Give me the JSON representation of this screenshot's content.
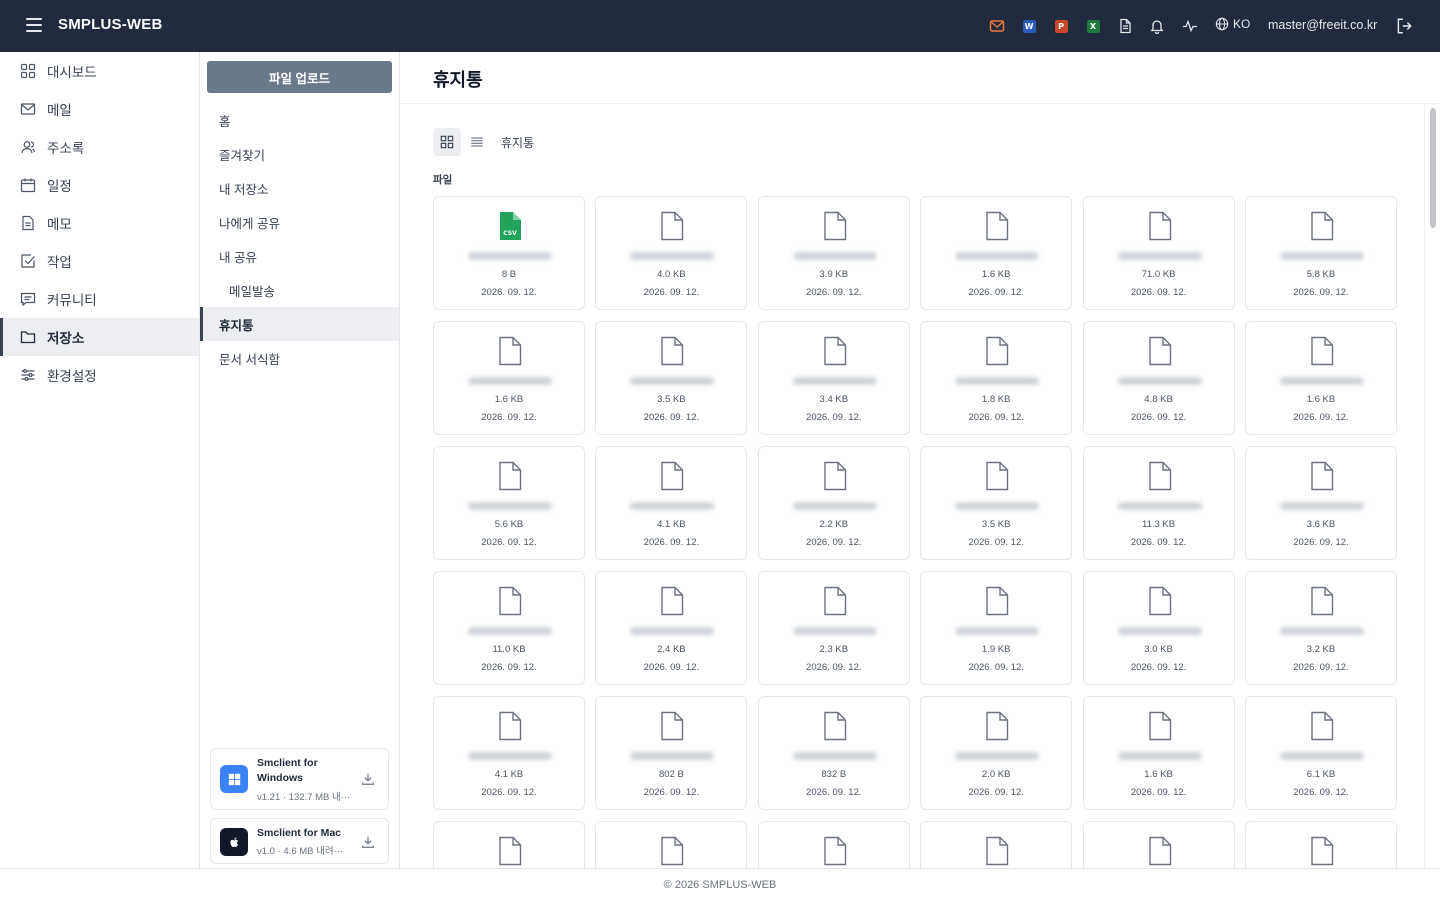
{
  "header": {
    "app_title": "SMPLUS-WEB",
    "icons": [
      "mail-icon",
      "word-icon",
      "powerpoint-icon",
      "excel-icon",
      "document-icon",
      "bell-icon",
      "activity-icon",
      "globe-icon"
    ],
    "word_letter": "W",
    "ppt_letter": "P",
    "excel_letter": "X",
    "lang": "KO",
    "user_email": "master@freeit.co.kr",
    "colors": {
      "bar": "#212b3d",
      "mail": "#f07a3e",
      "word": "#2b5cb8",
      "ppt": "#c8462c",
      "excel": "#1f7a3f"
    }
  },
  "leftnav": {
    "items": [
      {
        "label": "대시보드",
        "icon": "dashboard-icon",
        "active": false
      },
      {
        "label": "메일",
        "icon": "mail-icon",
        "active": false
      },
      {
        "label": "주소록",
        "icon": "contacts-icon",
        "active": false
      },
      {
        "label": "일정",
        "icon": "calendar-icon",
        "active": false
      },
      {
        "label": "메모",
        "icon": "memo-icon",
        "active": false
      },
      {
        "label": "작업",
        "icon": "task-icon",
        "active": false
      },
      {
        "label": "커뮤니티",
        "icon": "community-icon",
        "active": false
      },
      {
        "label": "저장소",
        "icon": "folder-icon",
        "active": true
      },
      {
        "label": "환경설정",
        "icon": "settings-icon",
        "active": false
      }
    ]
  },
  "subnav": {
    "upload_label": "파일 업로드",
    "items": [
      {
        "label": "홈"
      },
      {
        "label": "즐겨찾기"
      },
      {
        "label": "내 저장소"
      },
      {
        "label": "나에게 공유"
      },
      {
        "label": "내 공유"
      },
      {
        "label": "메일발송"
      },
      {
        "label": "휴지통"
      },
      {
        "label": "문서 서식함"
      }
    ],
    "apps": [
      {
        "name": "Smclient for Windows",
        "meta": "v1.21 · 132.7 MB 내···",
        "icon": "windows-icon"
      },
      {
        "name": "Smclient for Mac",
        "meta": "v1.0 · 4.6 MB 내려···",
        "icon": "apple-icon"
      }
    ]
  },
  "main": {
    "title": "휴지통",
    "breadcrumb": "휴지통",
    "section_label": "파일",
    "csv_tag": "CSV",
    "files": [
      {
        "type": "csv",
        "size": "8 B",
        "date": "2026. 09. 12."
      },
      {
        "type": "file",
        "size": "4.0 KB",
        "date": "2026. 09. 12."
      },
      {
        "type": "file",
        "size": "3.9 KB",
        "date": "2026. 09. 12."
      },
      {
        "type": "file",
        "size": "1.6 KB",
        "date": "2026. 09. 12."
      },
      {
        "type": "file",
        "size": "71.0 KB",
        "date": "2026. 09. 12."
      },
      {
        "type": "file",
        "size": "5.8 KB",
        "date": "2026. 09. 12."
      },
      {
        "type": "file",
        "size": "1.6 KB",
        "date": "2026. 09. 12."
      },
      {
        "type": "file",
        "size": "3.5 KB",
        "date": "2026. 09. 12."
      },
      {
        "type": "file",
        "size": "3.4 KB",
        "date": "2026. 09. 12."
      },
      {
        "type": "file",
        "size": "1.8 KB",
        "date": "2026. 09. 12."
      },
      {
        "type": "file",
        "size": "4.8 KB",
        "date": "2026. 09. 12."
      },
      {
        "type": "file",
        "size": "1.6 KB",
        "date": "2026. 09. 12."
      },
      {
        "type": "file",
        "size": "5.6 KB",
        "date": "2026. 09. 12."
      },
      {
        "type": "file",
        "size": "4.1 KB",
        "date": "2026. 09. 12."
      },
      {
        "type": "file",
        "size": "2.2 KB",
        "date": "2026. 09. 12."
      },
      {
        "type": "file",
        "size": "3.5 KB",
        "date": "2026. 09. 12."
      },
      {
        "type": "file",
        "size": "11.3 KB",
        "date": "2026. 09. 12."
      },
      {
        "type": "file",
        "size": "3.6 KB",
        "date": "2026. 09. 12."
      },
      {
        "type": "file",
        "size": "11.0 KB",
        "date": "2026. 09. 12."
      },
      {
        "type": "file",
        "size": "2.4 KB",
        "date": "2026. 09. 12."
      },
      {
        "type": "file",
        "size": "2.3 KB",
        "date": "2026. 09. 12."
      },
      {
        "type": "file",
        "size": "1.9 KB",
        "date": "2026. 09. 12."
      },
      {
        "type": "file",
        "size": "3.0 KB",
        "date": "2026. 09. 12."
      },
      {
        "type": "file",
        "size": "3.2 KB",
        "date": "2026. 09. 12."
      },
      {
        "type": "file",
        "size": "4.1 KB",
        "date": "2026. 09. 12."
      },
      {
        "type": "file",
        "size": "802 B",
        "date": "2026. 09. 12."
      },
      {
        "type": "file",
        "size": "832 B",
        "date": "2026. 09. 12."
      },
      {
        "type": "file",
        "size": "2.0 KB",
        "date": "2026. 09. 12."
      },
      {
        "type": "file",
        "size": "1.6 KB",
        "date": "2026. 09. 12."
      },
      {
        "type": "file",
        "size": "6.1 KB",
        "date": "2026. 09. 12."
      },
      {
        "type": "file",
        "size": "",
        "date": ""
      },
      {
        "type": "file",
        "size": "",
        "date": ""
      },
      {
        "type": "file",
        "size": "",
        "date": ""
      },
      {
        "type": "file",
        "size": "",
        "date": ""
      },
      {
        "type": "file",
        "size": "",
        "date": ""
      },
      {
        "type": "file",
        "size": "",
        "date": ""
      }
    ]
  },
  "footer": {
    "text": "© 2026 SMPLUS-WEB"
  }
}
